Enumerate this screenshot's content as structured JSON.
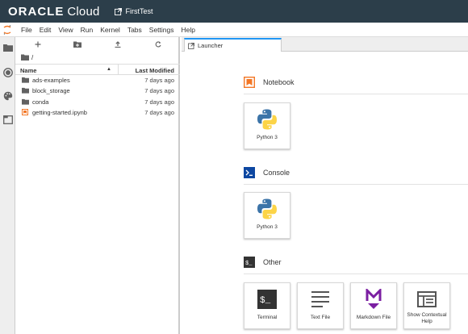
{
  "topbar": {
    "brand_bold": "ORACLE",
    "brand_light": "Cloud",
    "project": "FirstTest"
  },
  "menu": [
    "File",
    "Edit",
    "View",
    "Run",
    "Kernel",
    "Tabs",
    "Settings",
    "Help"
  ],
  "filebrowser": {
    "path": "/",
    "col_name": "Name",
    "col_modified": "Last Modified",
    "items": [
      {
        "name": "ads-examples",
        "modified": "7 days ago",
        "type": "folder"
      },
      {
        "name": "block_storage",
        "modified": "7 days ago",
        "type": "folder"
      },
      {
        "name": "conda",
        "modified": "7 days ago",
        "type": "folder"
      },
      {
        "name": "getting-started.ipynb",
        "modified": "7 days ago",
        "type": "notebook"
      }
    ]
  },
  "tab": {
    "label": "Launcher"
  },
  "launcher": {
    "notebook": {
      "title": "Notebook",
      "cards": [
        "Python 3"
      ]
    },
    "console": {
      "title": "Console",
      "cards": [
        "Python 3"
      ]
    },
    "other": {
      "title": "Other",
      "cards": [
        "Terminal",
        "Text File",
        "Markdown File",
        "Show Contextual Help"
      ]
    }
  },
  "colors": {
    "topbar": "#2c3e4a",
    "notebook_icon": "#f37726",
    "console_icon": "#0d47a1",
    "markdown": "#7b1fa2",
    "tab_accent": "#2196f3"
  }
}
